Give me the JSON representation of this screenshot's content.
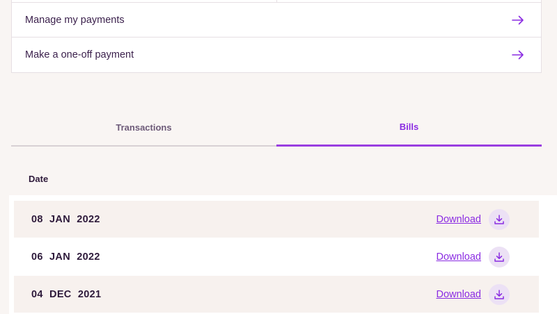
{
  "actions": {
    "items": [
      {
        "label": "Manage my payments",
        "icon": "arrow-right-icon"
      },
      {
        "label": "Make a one-off payment",
        "icon": "arrow-right-icon"
      }
    ]
  },
  "tabs": {
    "items": [
      {
        "label": "Transactions",
        "active": false
      },
      {
        "label": "Bills",
        "active": true
      }
    ]
  },
  "bills": {
    "column_header": "Date",
    "download_label": "Download",
    "download_icon": "download-icon",
    "rows": [
      {
        "date": "08 JAN 2022"
      },
      {
        "date": "06 JAN 2022"
      },
      {
        "date": "04 DEC 2021"
      }
    ]
  },
  "colors": {
    "accent": "#8a2be2",
    "background": "#f9f5f3",
    "text": "#3a1f4b",
    "row_shade": "#f7f1ee",
    "icon_bg": "#ece1f5"
  }
}
